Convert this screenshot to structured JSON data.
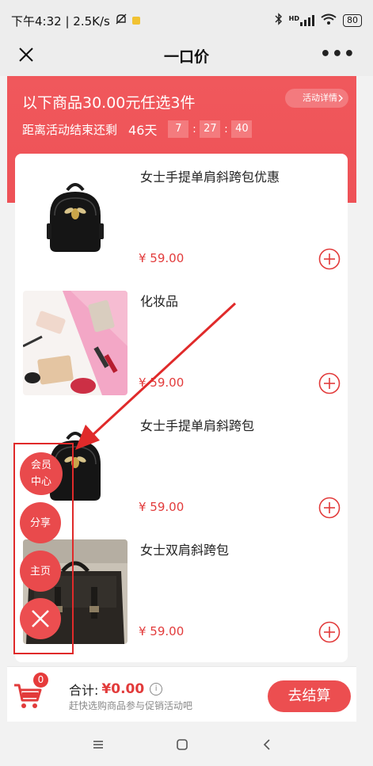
{
  "status_bar": {
    "time_and_speed": "下午4:32 | 2.5K/s",
    "signal_label": "HD",
    "battery": "80"
  },
  "nav": {
    "title": "一口价",
    "more_glyph": "•••"
  },
  "promo": {
    "title": "以下商品30.00元任选3件",
    "detail_button": "活动详情",
    "countdown_label": "距离活动结束还剩",
    "days": "46天",
    "hours": "7",
    "minutes": "27",
    "seconds": "40",
    "separator": ":"
  },
  "products": [
    {
      "name": "女士手提单肩斜跨包优惠",
      "price": "¥ 59.00",
      "image": "black-backpack-bee"
    },
    {
      "name": "化妆品",
      "price": "¥ 59.00",
      "image": "cosmetics-flatlay"
    },
    {
      "name": "女士手提单肩斜跨包",
      "price": "¥ 59.00",
      "image": "black-backpack-bee"
    },
    {
      "name": "女士双肩斜跨包",
      "price": "¥ 59.00",
      "image": "leather-satchel"
    }
  ],
  "float_menu": {
    "member_center": "会员中心",
    "share": "分享",
    "home": "主页"
  },
  "cart": {
    "badge_count": "0",
    "total_label": "合计:",
    "total_amount": "¥0.00",
    "info_glyph": "i",
    "hint": "赶快选购商品参与促销活动吧",
    "checkout": "去结算"
  },
  "colors": {
    "brand_red": "#ee5257",
    "price_red": "#e23b3b",
    "annotation_red": "#e02a2a"
  }
}
